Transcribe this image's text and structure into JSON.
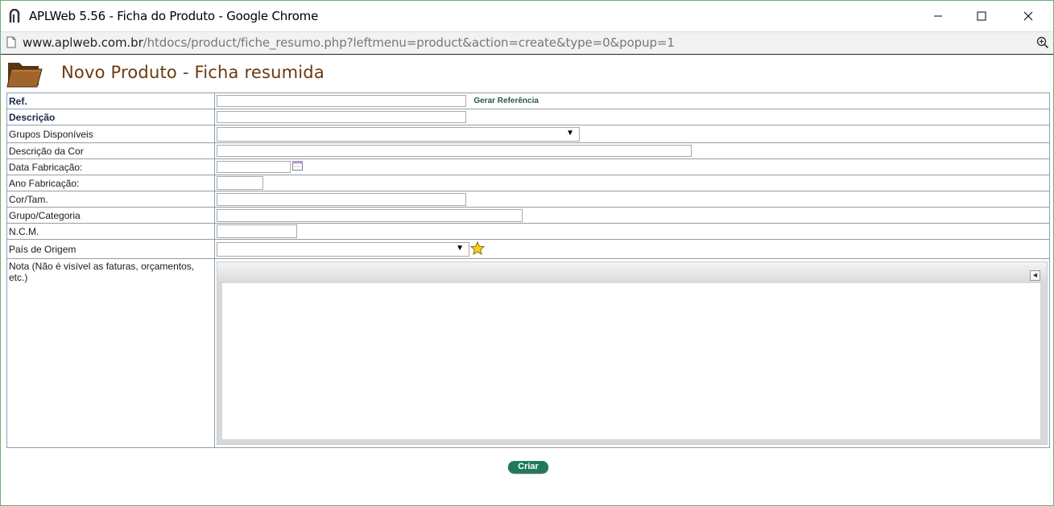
{
  "window": {
    "title": "APLWeb 5.56 - Ficha do Produto - Google Chrome",
    "url_host": "www.aplweb.com.br",
    "url_path": "/htdocs/product/fiche_resumo.php?leftmenu=product&action=create&type=0&popup=1"
  },
  "page": {
    "title": "Novo Produto - Ficha resumida"
  },
  "form": {
    "ref_label": "Ref.",
    "ref_value": "",
    "generate_ref_label": "Gerar Referência",
    "descricao_label": "Descrição",
    "descricao_value": "",
    "grupos_label": "Grupos Disponíveis",
    "grupos_selected": "",
    "descricao_cor_label": "Descrição da Cor",
    "descricao_cor_value": "",
    "data_fabricacao_label": "Data Fabricação:",
    "data_fabricacao_value": "",
    "ano_fabricacao_label": "Ano Fabricação:",
    "ano_fabricacao_value": "",
    "cor_tam_label": "Cor/Tam.",
    "cor_tam_value": "",
    "grupo_categoria_label": "Grupo/Categoria",
    "grupo_categoria_value": "",
    "ncm_label": "N.C.M.",
    "ncm_value": "",
    "pais_origem_label": "País de Origem",
    "pais_origem_selected": "",
    "nota_label": "Nota (Não é visível as faturas, orçamentos, etc.)",
    "nota_value": ""
  },
  "actions": {
    "create_label": "Criar"
  },
  "colors": {
    "title_brown": "#6b3a0e",
    "button_green": "#1e7a5e",
    "window_border": "#6fae78"
  },
  "icons": [
    "app-icon",
    "minimize-icon",
    "maximize-icon",
    "close-icon",
    "page-icon",
    "zoom-icon",
    "folder-icon",
    "calendar-icon",
    "star-icon",
    "collapse-icon"
  ]
}
